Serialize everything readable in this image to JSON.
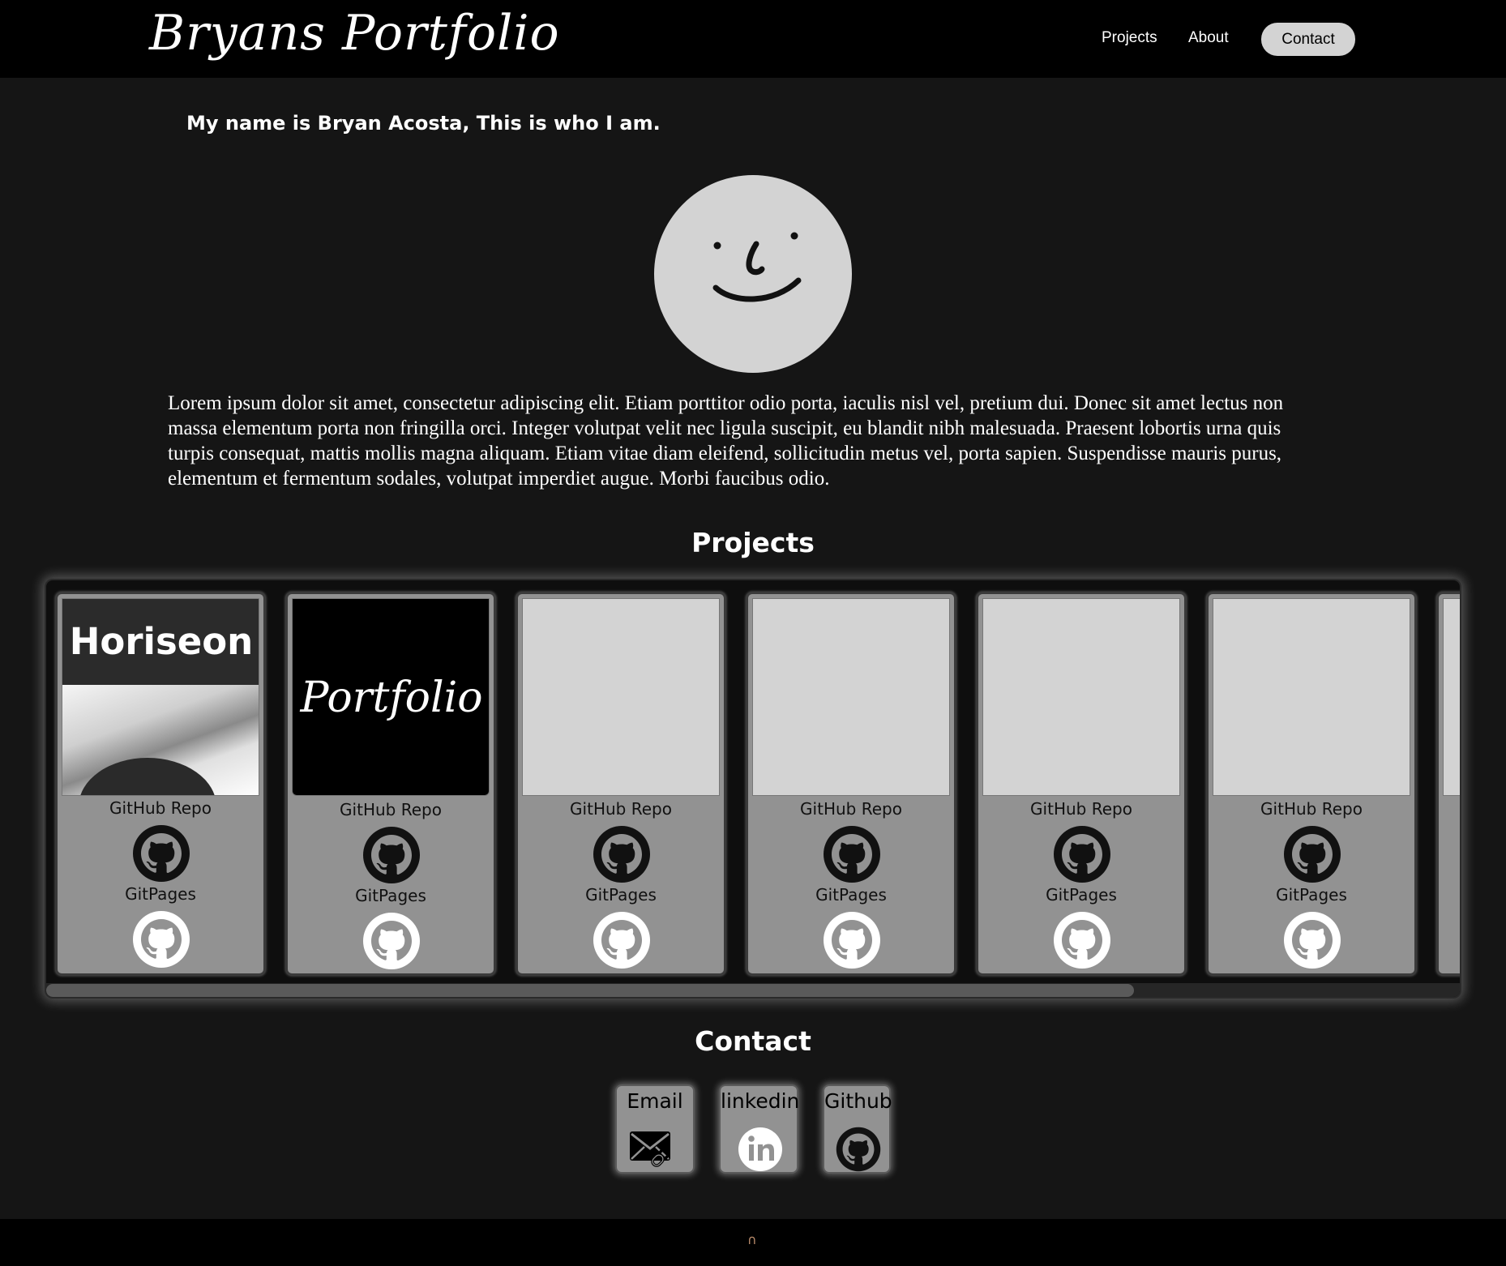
{
  "header": {
    "logo_text": "Bryans Portfolio",
    "nav": {
      "projects": "Projects",
      "about": "About",
      "contact": "Contact"
    }
  },
  "about": {
    "intro": "My name is Bryan Acosta, This is who I am.",
    "bio": "Lorem ipsum dolor sit amet, consectetur adipiscing elit. Etiam porttitor odio porta, iaculis nisl vel, pretium dui. Donec sit amet lectus non massa elementum porta non fringilla orci. Integer volutpat velit nec ligula suscipit, eu blandit nibh malesuada. Praesent lobortis urna quis turpis consequat, mattis mollis magna aliquam. Etiam vitae diam eleifend, sollicitudin metus vel, porta sapien. Suspendisse mauris purus, elementum et fermentum sodales, volutpat imperdiet augue. Morbi faucibus odio."
  },
  "projects": {
    "title": "Projects",
    "cards": [
      {
        "thumb_text": "Horiseon",
        "repo_label": "GitHub Repo",
        "pages_label": "GitPages"
      },
      {
        "thumb_text": "Portfolio",
        "repo_label": "GitHub Repo",
        "pages_label": "GitPages"
      },
      {
        "thumb_text": "",
        "repo_label": "GitHub Repo",
        "pages_label": "GitPages"
      },
      {
        "thumb_text": "",
        "repo_label": "GitHub Repo",
        "pages_label": "GitPages"
      },
      {
        "thumb_text": "",
        "repo_label": "GitHub Repo",
        "pages_label": "GitPages"
      },
      {
        "thumb_text": "",
        "repo_label": "GitHub Repo",
        "pages_label": "GitPages"
      }
    ]
  },
  "contact": {
    "title": "Contact",
    "items": [
      {
        "label": "Email",
        "icon": "email-link-icon"
      },
      {
        "label": "linkedin",
        "icon": "linkedin-icon"
      },
      {
        "label": "Github",
        "icon": "github-icon"
      }
    ]
  },
  "colors": {
    "background": "#151515",
    "header": "#000000",
    "card": "#929292",
    "thumb_placeholder": "#d3d3d3",
    "nav_pill": "#d3d3d3"
  }
}
